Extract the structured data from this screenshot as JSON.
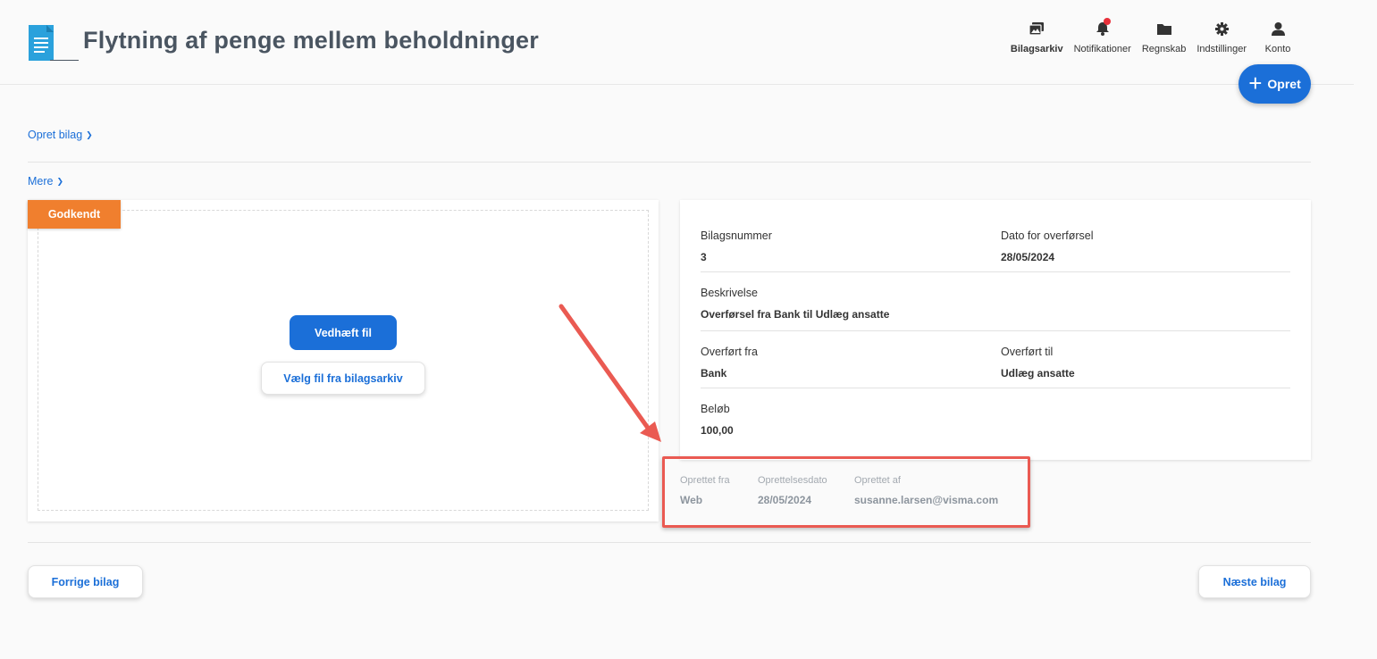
{
  "header": {
    "title": "Flytning af penge mellem beholdninger",
    "nav": [
      {
        "label": "Bilagsarkiv",
        "icon": "photo-archive-icon"
      },
      {
        "label": "Notifikationer",
        "icon": "bell-icon"
      },
      {
        "label": "Regnskab",
        "icon": "folder-icon"
      },
      {
        "label": "Indstillinger",
        "icon": "gear-icon"
      },
      {
        "label": "Konto",
        "icon": "user-icon"
      }
    ],
    "create_label": "Opret"
  },
  "sections": {
    "create_voucher": "Opret bilag",
    "more": "Mere"
  },
  "attachment": {
    "status": "Godkendt",
    "attach_label": "Vedhæft fil",
    "archive_label": "Vælg fil fra bilagsarkiv"
  },
  "details": {
    "voucher_number_label": "Bilagsnummer",
    "voucher_number": "3",
    "transfer_date_label": "Dato for overførsel",
    "transfer_date": "28/05/2024",
    "description_label": "Beskrivelse",
    "description": "Overførsel fra Bank til Udlæg ansatte",
    "from_label": "Overført fra",
    "from": "Bank",
    "to_label": "Overført til",
    "to": "Udlæg ansatte",
    "amount_label": "Beløb",
    "amount": "100,00"
  },
  "meta": {
    "created_from_label": "Oprettet fra",
    "created_from": "Web",
    "created_date_label": "Oprettelsesdato",
    "created_date": "28/05/2024",
    "created_by_label": "Oprettet af",
    "created_by": "susanne.larsen@visma.com"
  },
  "footer": {
    "prev_label": "Forrige bilag",
    "next_label": "Næste bilag"
  },
  "colors": {
    "primary": "#1b6fd8",
    "status": "#f07f2e",
    "highlight": "#ea5a52"
  }
}
